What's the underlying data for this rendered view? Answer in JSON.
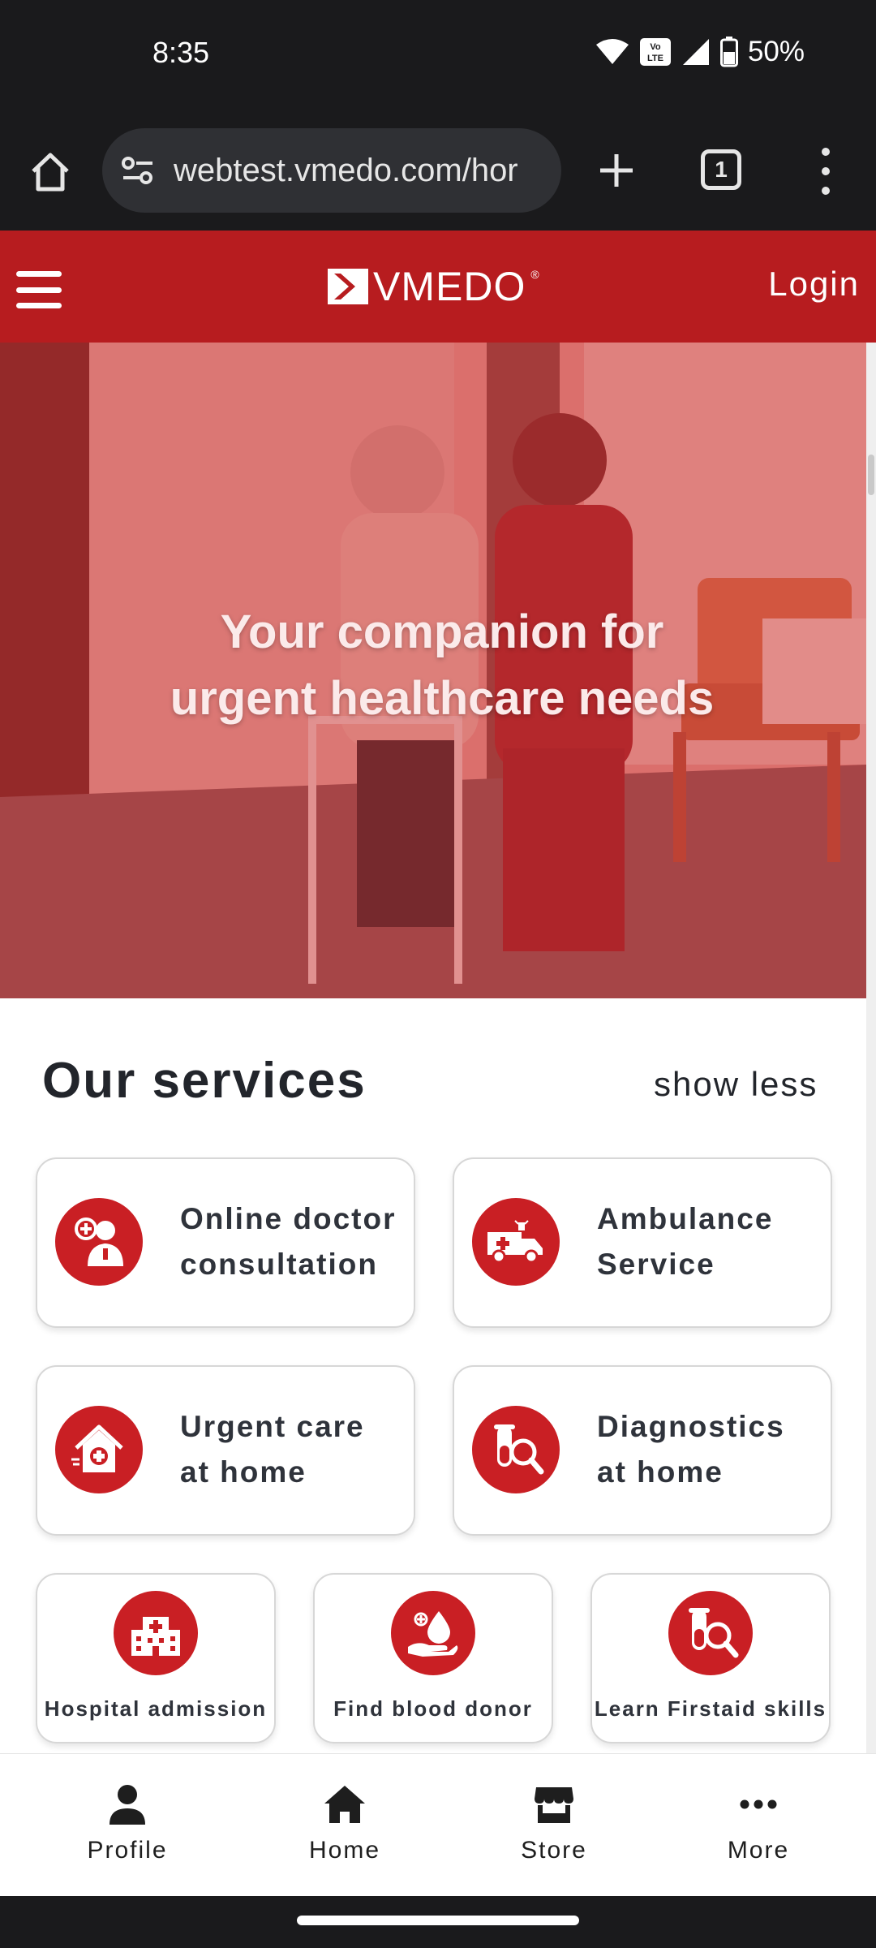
{
  "status_bar": {
    "time": "8:35",
    "battery": "50%"
  },
  "browser": {
    "url": "webtest.vmedo.com/hor",
    "tab_count": "1"
  },
  "header": {
    "logo_text": "VMEDO",
    "logo_mark": "®",
    "login_label": "Login"
  },
  "hero": {
    "title_line1": "Your companion for",
    "title_line2": "urgent healthcare needs"
  },
  "services": {
    "title": "Our services",
    "toggle_label": "show less",
    "big_cards": [
      {
        "line1": "Online doctor",
        "line2": "consultation",
        "icon": "doctor-icon"
      },
      {
        "line1": "Ambulance",
        "line2": "Service",
        "icon": "ambulance-icon"
      },
      {
        "line1": "Urgent care",
        "line2": "at home",
        "icon": "home-care-icon"
      },
      {
        "line1": "Diagnostics",
        "line2": "at home",
        "icon": "test-tube-icon"
      }
    ],
    "small_cards": [
      {
        "label": "Hospital admission",
        "icon": "hospital-icon"
      },
      {
        "label": "Find blood donor",
        "icon": "blood-donor-icon"
      },
      {
        "label": "Learn Firstaid skills",
        "icon": "first-aid-icon"
      }
    ]
  },
  "bottom_nav": [
    {
      "label": "Profile",
      "icon": "person-icon"
    },
    {
      "label": "Home",
      "icon": "home-icon"
    },
    {
      "label": "Store",
      "icon": "store-icon"
    },
    {
      "label": "More",
      "icon": "more-dots-icon"
    }
  ],
  "colors": {
    "brand_red": "#b71c1f",
    "icon_red": "#c91f24",
    "chrome_dark": "#1a1a1c"
  }
}
